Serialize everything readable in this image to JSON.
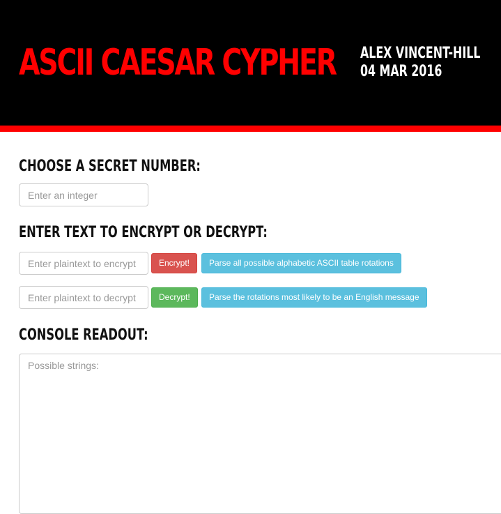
{
  "header": {
    "title": "ASCII CAESAR CYPHER",
    "author": "ALEX VINCENT-HILL",
    "date": "04 MAR 2016"
  },
  "secret": {
    "heading": "CHOOSE A SECRET NUMBER:",
    "placeholder": "Enter an integer"
  },
  "text": {
    "heading": "ENTER TEXT TO ENCRYPT OR DECRYPT:",
    "encrypt_placeholder": "Enter plaintext to encrypt",
    "encrypt_button": "Encrypt!",
    "parse_all_button": "Parse all possible alphabetic ASCII table rotations",
    "decrypt_placeholder": "Enter plaintext to decrypt",
    "decrypt_button": "Decrypt!",
    "parse_likely_button": "Parse the rotations most likely to be an English message"
  },
  "console": {
    "heading": "CONSOLE READOUT:",
    "placeholder": "Possible strings:"
  },
  "colors": {
    "header_bg": "#000000",
    "accent": "#ff0000",
    "danger": "#d9534f",
    "success": "#5cb85c",
    "info": "#5bc0de"
  }
}
